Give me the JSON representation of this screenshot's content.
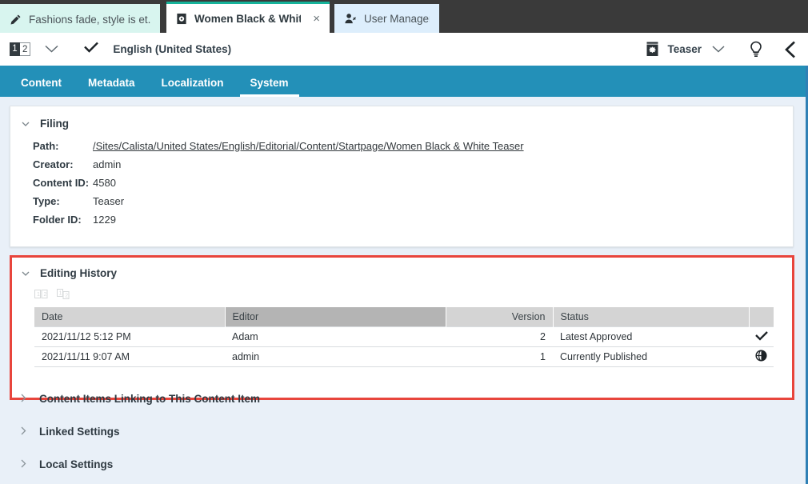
{
  "tabs": [
    {
      "label": "Fashions fade, style is et...",
      "icon": "pencil-icon",
      "active": false,
      "closable": false
    },
    {
      "label": "Women Black & White Te...",
      "icon": "content-item-icon",
      "active": true,
      "closable": true,
      "close_label": "×"
    },
    {
      "label": "User Manager",
      "icon": "user-manager-icon",
      "active": false,
      "closable": false
    }
  ],
  "toolbar": {
    "version_from": "1",
    "version_to": "2",
    "version_dropdown_icon": "chevron-down-icon",
    "approved_check_icon": "check-icon",
    "language": "English (United States)",
    "content_type_icon": "teaser-icon",
    "content_type": "Teaser",
    "content_type_dropdown_icon": "chevron-down-icon",
    "help_icon": "lightbulb-icon",
    "collapse_icon": "chevron-left-icon"
  },
  "nav": {
    "items": [
      {
        "label": "Content",
        "active": false
      },
      {
        "label": "Metadata",
        "active": false
      },
      {
        "label": "Localization",
        "active": false
      },
      {
        "label": "System",
        "active": true
      }
    ]
  },
  "filing": {
    "title": "Filing",
    "expanded": true,
    "caret_icon": "chevron-down-icon",
    "fields": [
      {
        "label": "Path:",
        "value": "/Sites/Calista/United States/English/Editorial/Content/Startpage/Women Black & White Teaser",
        "is_link": true
      },
      {
        "label": "Creator:",
        "value": "admin",
        "is_link": false
      },
      {
        "label": "Content ID:",
        "value": "4580",
        "is_link": false
      },
      {
        "label": "Type:",
        "value": "Teaser",
        "is_link": false
      },
      {
        "label": "Folder ID:",
        "value": "1229",
        "is_link": false
      }
    ]
  },
  "editing_history": {
    "title": "Editing History",
    "expanded": true,
    "caret_icon": "chevron-down-icon",
    "highlighted": true,
    "highlight_color": "#e8453c",
    "toolbar_icons": [
      {
        "name": "compare-versions-icon",
        "disabled": true
      },
      {
        "name": "compare-with-current-icon",
        "disabled": true
      }
    ],
    "columns": [
      {
        "label": "Date",
        "align": "left",
        "highlighted": false
      },
      {
        "label": "Editor",
        "align": "left",
        "highlighted": true
      },
      {
        "label": "Version",
        "align": "right",
        "highlighted": false
      },
      {
        "label": "Status",
        "align": "left",
        "highlighted": false
      },
      {
        "label": "",
        "align": "center",
        "highlighted": false
      }
    ],
    "rows": [
      {
        "date": "2021/11/12 5:12 PM",
        "editor": "Adam",
        "version": "2",
        "status": "Latest Approved",
        "icon": "check-icon"
      },
      {
        "date": "2021/11/11 9:07 AM",
        "editor": "admin",
        "version": "1",
        "status": "Currently Published",
        "icon": "published-globe-icon"
      }
    ]
  },
  "sections": [
    {
      "label": "Content Items Linking to This Content Item",
      "expanded": false,
      "caret_icon": "chevron-right-icon"
    },
    {
      "label": "Linked Settings",
      "expanded": false,
      "caret_icon": "chevron-right-icon"
    },
    {
      "label": "Local Settings",
      "expanded": false,
      "caret_icon": "chevron-right-icon"
    }
  ],
  "colors": {
    "nav_bar": "#2390b8",
    "active_tab_accent": "#16b39a",
    "content_bg": "#e9f0f8",
    "highlight": "#e8453c"
  }
}
